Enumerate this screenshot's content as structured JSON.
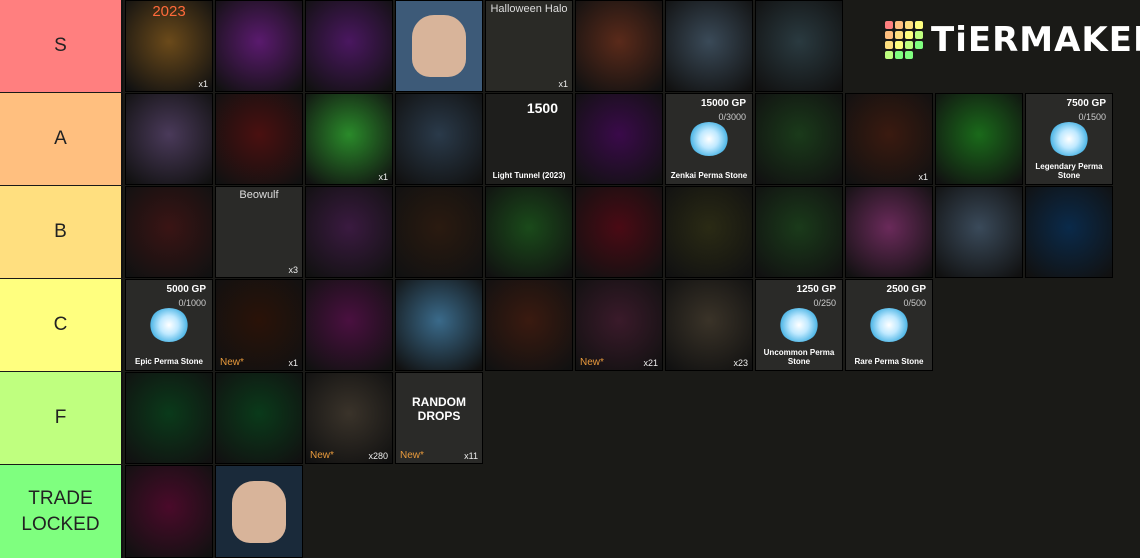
{
  "brand": {
    "logo_text": "TiERMAKER"
  },
  "tiers": [
    {
      "label": "S",
      "color": "#ff7f7f",
      "items": [
        {
          "bg": "#6b4a1a",
          "kind": "art",
          "top_text": "2023",
          "qty": "x1"
        },
        {
          "bg": "#5a1a6e",
          "kind": "art"
        },
        {
          "bg": "#4a1760",
          "kind": "art"
        },
        {
          "bg": "#3d5a78",
          "kind": "face"
        },
        {
          "bg": "#2a2a26",
          "kind": "named",
          "name": "Halloween Halo",
          "qty": "x1"
        },
        {
          "bg": "#5a2a1a",
          "kind": "art"
        },
        {
          "bg": "#3a4a58",
          "kind": "art"
        },
        {
          "bg": "#2a3a40",
          "kind": "art"
        }
      ]
    },
    {
      "label": "A",
      "color": "#ffbf7f",
      "items": [
        {
          "bg": "#4a3a5a",
          "kind": "art"
        },
        {
          "bg": "#4a1010",
          "kind": "art"
        },
        {
          "bg": "#2a8a2a",
          "kind": "art",
          "qty": "x1"
        },
        {
          "bg": "#2a3a4a",
          "kind": "art"
        },
        {
          "bg": "#1e1e1c",
          "kind": "gp",
          "gp": "1500",
          "caption": "Light Tunnel (2023)"
        },
        {
          "bg": "#3a0a4a",
          "kind": "art"
        },
        {
          "bg": "#2a2a28",
          "kind": "stone",
          "gp": "15000 GP",
          "sub": "0/3000",
          "caption": "Zenkai Perma Stone"
        },
        {
          "bg": "#1a3a1a",
          "kind": "art"
        },
        {
          "bg": "#3a1a10",
          "kind": "art",
          "qty": "x1"
        },
        {
          "bg": "#1a6a1a",
          "kind": "art"
        },
        {
          "bg": "#2a2a28",
          "kind": "stone",
          "gp": "7500 GP",
          "sub": "0/1500",
          "caption": "Legendary Perma Stone"
        }
      ]
    },
    {
      "label": "B",
      "color": "#ffdf7f",
      "items": [
        {
          "bg": "#3a1414",
          "kind": "art"
        },
        {
          "bg": "#2a2a28",
          "kind": "named",
          "name": "Beowulf",
          "qty": "x3"
        },
        {
          "bg": "#3a1a40",
          "kind": "art"
        },
        {
          "bg": "#2a1a10",
          "kind": "art"
        },
        {
          "bg": "#1a4a1a",
          "kind": "art"
        },
        {
          "bg": "#4a0a14",
          "kind": "art"
        },
        {
          "bg": "#2a2a14",
          "kind": "art"
        },
        {
          "bg": "#1a3a1a",
          "kind": "art"
        },
        {
          "bg": "#6a2a5a",
          "kind": "art"
        },
        {
          "bg": "#3a4a5a",
          "kind": "art"
        },
        {
          "bg": "#0a2a4a",
          "kind": "art"
        }
      ]
    },
    {
      "label": "C",
      "color": "#ffff7f",
      "items": [
        {
          "bg": "#2a2a28",
          "kind": "stone",
          "gp": "5000 GP",
          "sub": "0/1000",
          "caption": "Epic Perma Stone"
        },
        {
          "bg": "#2a1208",
          "kind": "art",
          "new": "New*",
          "qty": "x1"
        },
        {
          "bg": "#4a1040",
          "kind": "art"
        },
        {
          "bg": "#3a6a8a",
          "kind": "art"
        },
        {
          "bg": "#3a1a10",
          "kind": "art"
        },
        {
          "bg": "#3a1a2a",
          "kind": "art",
          "new": "New*",
          "qty": "x21"
        },
        {
          "bg": "#3a3328",
          "kind": "art",
          "qty": "x23"
        },
        {
          "bg": "#2a2a28",
          "kind": "stone",
          "gp": "1250 GP",
          "sub": "0/250",
          "caption": "Uncommon Perma Stone"
        },
        {
          "bg": "#2a2a28",
          "kind": "stone",
          "gp": "2500 GP",
          "sub": "0/500",
          "caption": "Rare Perma Stone"
        }
      ]
    },
    {
      "label": "F",
      "color": "#bfff7f",
      "items": [
        {
          "bg": "#0a3a1a",
          "kind": "art"
        },
        {
          "bg": "#0a3a1a",
          "kind": "art"
        },
        {
          "bg": "#3a332a",
          "kind": "art",
          "new": "New*",
          "qty": "x280"
        },
        {
          "bg": "#2a2a28",
          "kind": "named",
          "name": "RANDOM DROPS",
          "new": "New*",
          "qty": "x11"
        }
      ]
    },
    {
      "label": "TRADE LOCKED",
      "color": "#7fff7f",
      "items": [
        {
          "bg": "#4a0a2a",
          "kind": "art"
        },
        {
          "bg": "#1a2a3a",
          "kind": "face"
        }
      ]
    }
  ]
}
